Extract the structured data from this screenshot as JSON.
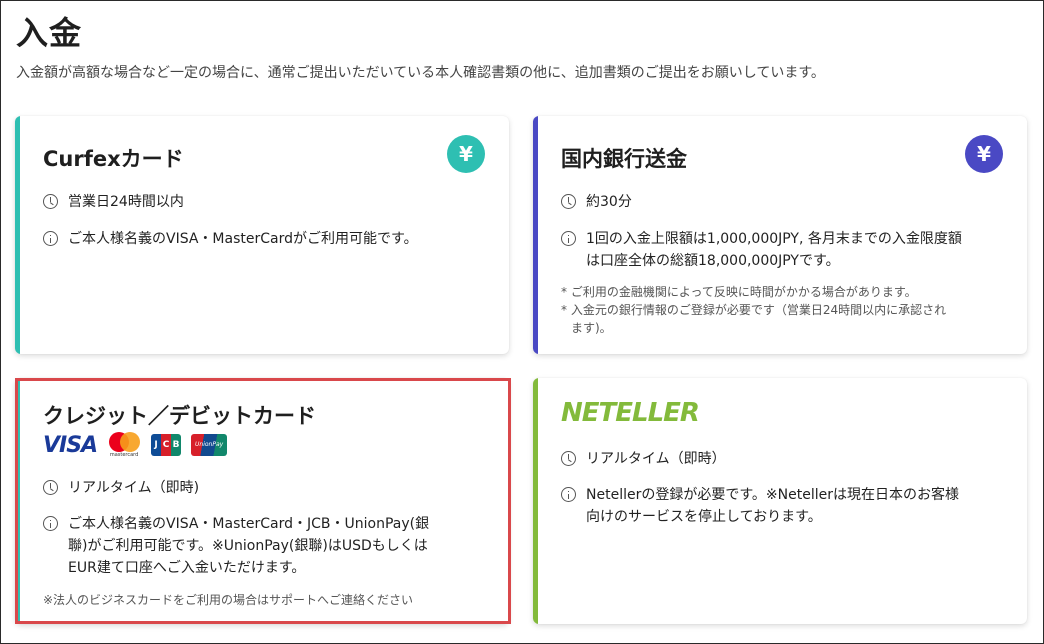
{
  "page": {
    "title": "入金",
    "description": "入金額が高額な場合など一定の場合に、通常ご提出いただいている本人確認書類の他に、追加書類のご提出をお願いしています。"
  },
  "colors": {
    "curfex_accent": "#2ebfb2",
    "bank_accent": "#4a49c4",
    "credit_accent": "#2ebfb2",
    "neteller_accent": "#83ba3b",
    "highlight_border": "#d9484b"
  },
  "cards": {
    "curfex": {
      "title": "Curfexカード",
      "icon": "yen-icon",
      "yen_symbol": "¥",
      "time": "営業日24時間以内",
      "info": "ご本人様名義のVISA・MasterCardがご利用可能です。"
    },
    "bank": {
      "title": "国内銀行送金",
      "icon": "yen-icon",
      "yen_symbol": "¥",
      "time": "約30分",
      "info_line1": "1回の入金上限額は1,000,000JPY, 各月末までの入金限度額",
      "info_line2": "は口座全体の総額18,000,000JPYです。",
      "note1": "* ご利用の金融機関によって反映に時間がかかる場合があります。",
      "note2_line1": "* 入金元の銀行情報のご登録が必要です（営業日24時間以内に承認され",
      "note2_line2": "ます)。"
    },
    "credit": {
      "title": "クレジット／デビットカード",
      "logos": {
        "visa": "VISA",
        "mastercard": "mastercard",
        "jcb": [
          "J",
          "C",
          "B"
        ],
        "unionpay": "UnionPay 银联"
      },
      "time": "リアルタイム（即時)",
      "info_line1": "ご本人様名義のVISA・MasterCard・JCB・UnionPay(銀",
      "info_line2": "聯)がご利用可能です。※UnionPay(銀聯)はUSDもしくは",
      "info_line3": "EUR建て口座へご入金いただけます。",
      "note": "※法人のビジネスカードをご利用の場合はサポートへご連絡ください"
    },
    "neteller": {
      "logo_text": "NETELLER",
      "time": "リアルタイム（即時）",
      "info_line1": "Netellerの登録が必要です。※Netellerは現在日本のお客様",
      "info_line2": "向けのサービスを停止しております。"
    }
  }
}
